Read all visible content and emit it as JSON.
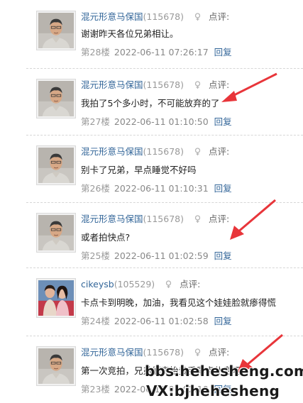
{
  "comments": [
    {
      "avatar": "man-portrait",
      "username": "混元形意马保国",
      "uid": "(115678)",
      "review_label": "点评:",
      "content": "谢谢昨天各位兄弟相让。",
      "floor": "第28楼",
      "time": "2022-06-11 07:26:17",
      "reply": "回复"
    },
    {
      "avatar": "man-portrait",
      "username": "混元形意马保国",
      "uid": "(115678)",
      "review_label": "点评:",
      "content": "我拍了5个多小时，不可能放弃的了",
      "floor": "第27楼",
      "time": "2022-06-11 01:10:50",
      "reply": "回复"
    },
    {
      "avatar": "man-portrait",
      "username": "混元形意马保国",
      "uid": "(115678)",
      "review_label": "点评:",
      "content": "别卡了兄弟，早点睡觉不好吗",
      "floor": "第26楼",
      "time": "2022-06-11 01:10:31",
      "reply": "回复"
    },
    {
      "avatar": "man-portrait",
      "username": "混元形意马保国",
      "uid": "(115678)",
      "review_label": "点评:",
      "content": "或者拍快点?",
      "floor": "第25楼",
      "time": "2022-06-11 01:02:59",
      "reply": "回复"
    },
    {
      "avatar": "couple-photo",
      "username": "cikeysb",
      "uid": "(105529)",
      "review_label": "点评:",
      "content": "卡点卡到明晚，加油，我看见这个娃娃脸就瘆得慌",
      "floor": "第24楼",
      "time": "2022-06-11 01:02:58",
      "reply": "回复"
    },
    {
      "avatar": "man-portrait",
      "username": "混元形意马保国",
      "uid": "(115678)",
      "review_label": "点评:",
      "content": "第一次竞拍，兄弟们高抬贵手早点休息吧",
      "floor": "第23楼",
      "time": "2022-06-11 01:02:10",
      "reply": "回复"
    }
  ],
  "watermark": {
    "line1": "bbs.hehesheng.com",
    "line2": "VX:bjhehesheng"
  },
  "colors": {
    "username": "#336699",
    "arrow": "#e8353a",
    "separator": "#d6d6d6"
  }
}
